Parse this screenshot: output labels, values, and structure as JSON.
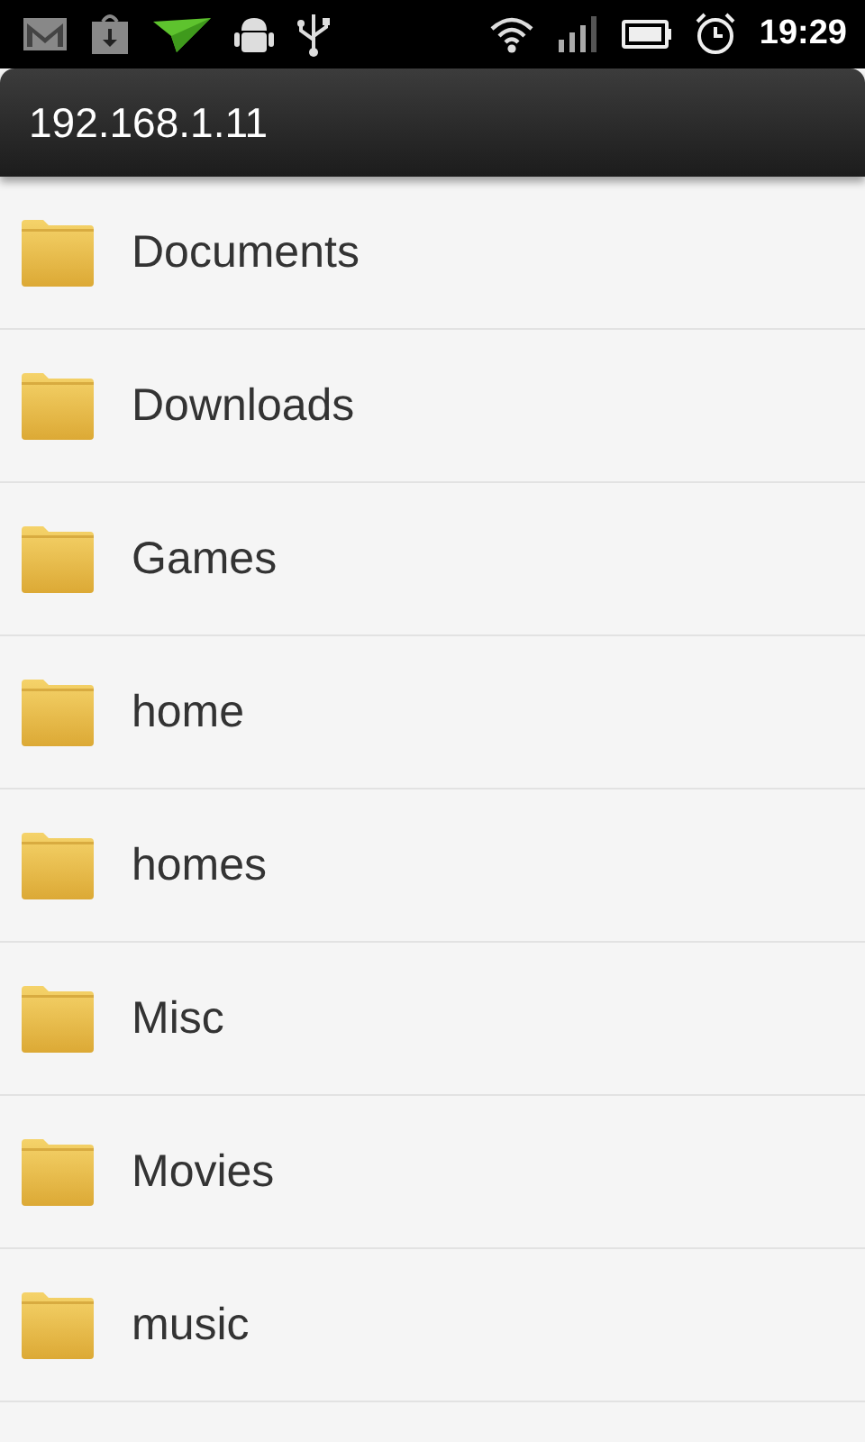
{
  "status_bar": {
    "time": "19:29"
  },
  "title_bar": {
    "title": "192.168.1.11"
  },
  "folders": [
    {
      "name": "Documents"
    },
    {
      "name": "Downloads"
    },
    {
      "name": "Games"
    },
    {
      "name": "home"
    },
    {
      "name": "homes"
    },
    {
      "name": "Misc"
    },
    {
      "name": "Movies"
    },
    {
      "name": "music"
    }
  ]
}
